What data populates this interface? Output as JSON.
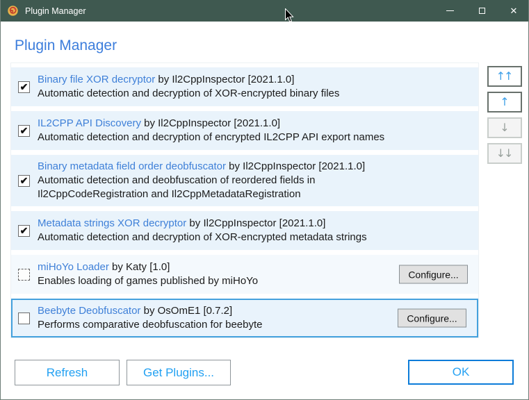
{
  "window": {
    "title": "Plugin Manager",
    "controls": {
      "minimize": "–",
      "maximize": "",
      "close": "✕"
    }
  },
  "header": {
    "title": "Plugin Manager"
  },
  "list": {
    "configure_label": "Configure..."
  },
  "glyphs": {
    "check": "✔"
  },
  "plugins": [
    {
      "name": "Binary file XOR decryptor",
      "author": "Il2CppInspector",
      "version": "2021.1.0",
      "description_lines": [
        "Automatic detection and decryption of XOR-encrypted binary files"
      ],
      "state": "checked",
      "configure": false,
      "selected": false
    },
    {
      "name": "IL2CPP API Discovery",
      "author": "Il2CppInspector",
      "version": "2021.1.0",
      "description_lines": [
        "Automatic detection and decryption of encrypted IL2CPP API export names"
      ],
      "state": "checked",
      "configure": false,
      "selected": false
    },
    {
      "name": "Binary metadata field order deobfuscator",
      "author": "Il2CppInspector",
      "version": "2021.1.0",
      "description_lines": [
        "Automatic detection and deobfuscation of reordered fields in",
        "Il2CppCodeRegistration and Il2CppMetadataRegistration"
      ],
      "state": "checked",
      "configure": false,
      "selected": false
    },
    {
      "name": "Metadata strings XOR decryptor",
      "author": "Il2CppInspector",
      "version": "2021.1.0",
      "description_lines": [
        "Automatic detection and decryption of XOR-encrypted metadata strings"
      ],
      "state": "checked",
      "configure": false,
      "selected": false
    },
    {
      "name": "miHoYo Loader",
      "author": "Katy",
      "version": "1.0",
      "description_lines": [
        "Enables loading of games published by miHoYo"
      ],
      "state": "indeterminate",
      "configure": true,
      "selected": false
    },
    {
      "name": "Beebyte Deobfuscator",
      "author": "OsOmE1",
      "version": "0.7.2",
      "description_lines": [
        "Performs comparative deobfuscation for beebyte"
      ],
      "state": "unchecked",
      "configure": true,
      "selected": true
    }
  ],
  "reorder": {
    "buttons": [
      {
        "name": "move-to-top-button",
        "glyph": "↑↑",
        "enabled": true
      },
      {
        "name": "move-up-button",
        "glyph": "↑",
        "enabled": true
      },
      {
        "name": "move-down-button",
        "glyph": "↓",
        "enabled": false
      },
      {
        "name": "move-to-bottom-button",
        "glyph": "↓↓",
        "enabled": false
      }
    ]
  },
  "footer": {
    "refresh_label": "Refresh",
    "get_plugins_label": "Get Plugins...",
    "ok_label": "OK"
  },
  "colors": {
    "titlebar_bg": "#3f5950",
    "heading_blue": "#3d7edc",
    "link_blue": "#3f80d8",
    "row_bg": "#e9f3fb",
    "selected_border": "#44a1dd",
    "button_text_blue": "#21a0f2",
    "ok_border_blue": "#0c7cd9"
  }
}
